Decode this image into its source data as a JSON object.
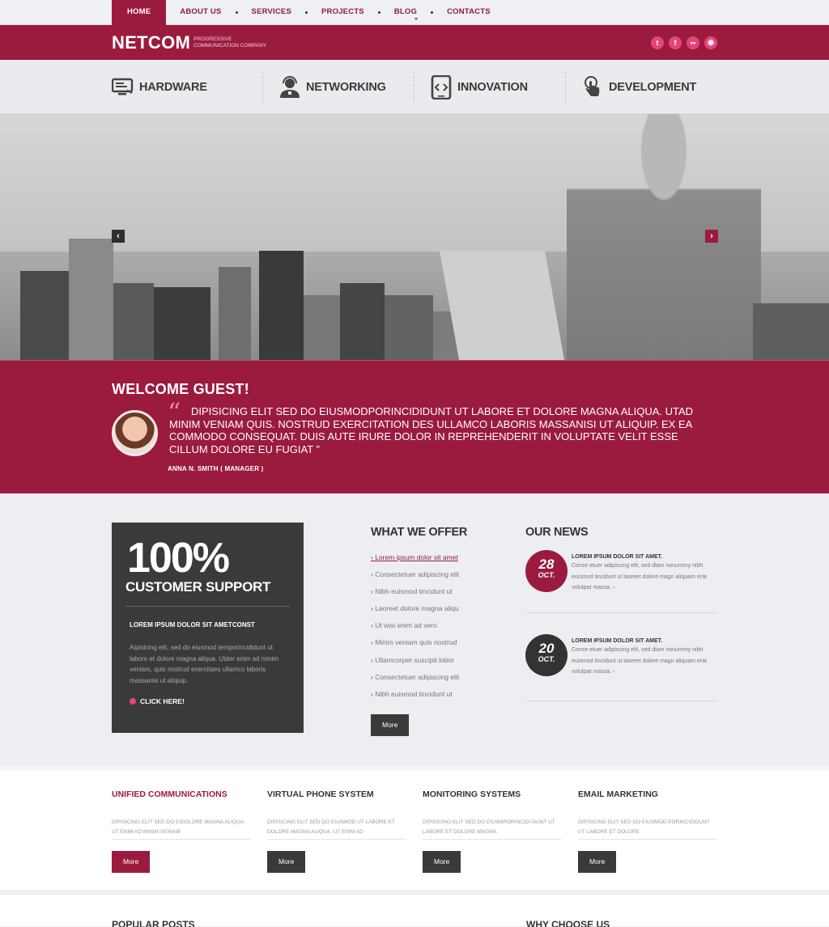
{
  "nav": {
    "items": [
      "HOME",
      "ABOUT US",
      "SERVICES",
      "PROJECTS",
      "BLOG",
      "CONTACTS"
    ]
  },
  "brand": {
    "logo": "NETCOM",
    "tagline_line1": "PROGRESSIVE",
    "tagline_line2": "COMMUNICATION COMPANY",
    "social": [
      "twitter-icon",
      "facebook-icon",
      "flickr-icon",
      "rss-icon"
    ],
    "accent_color": "#9b1b3f"
  },
  "services": [
    {
      "label": "HARDWARE",
      "icon": "monitor-icon"
    },
    {
      "label": "NETWORKING",
      "icon": "headset-user-icon"
    },
    {
      "label": "INNOVATION",
      "icon": "code-device-icon"
    },
    {
      "label": "DEVELOPMENT",
      "icon": "touch-icon"
    }
  ],
  "welcome": {
    "title": "WELCOME GUEST!",
    "quote": "DIPISICING ELIT SED DO EIUSMODPORINCIDIDUNT UT LABORE ET DOLORE MAGNA ALIQUA. UTAD MINIM VENIAM QUIS. NOSTRUD EXERCITATION DES ULLAMCO LABORIS MASSANISI UT ALIQUIP. EX EA COMMODO CONSEQUAT. DUIS AUTE IRURE DOLOR IN REPREHENDERIT IN VOLUPTATE VELIT ESSE CILLUM DOLORE EU FUGIAT ”",
    "author": "ANNA N. SMITH   ( MANAGER )"
  },
  "support": {
    "big": "100%",
    "sub": "CUSTOMER SUPPORT",
    "heading": "LOREM IPSUM DOLOR SIT AMETCONST",
    "text": "Aipisicing elit, sed do eiusmod temporincididunt ut labore et dolore magna aliqua. Utder enim ad minim veniam, quis nostrud exercitaes ullamco laboris massanisi ut aliquip.",
    "cta": "CLICK HERE!"
  },
  "offer": {
    "title": "WHAT WE OFFER",
    "items": [
      "Lorem ipsum dolor sit amet",
      "Consectetuer adipiscing elit",
      "Nibh euismod tincidunt ut",
      "Laoreet dolore magna aliqu",
      "Ut wisi enim ad vero",
      "Minim veniam quis nostrud",
      "Ullamcorper suscipit lobor",
      "Consectetuer adipiscing elit",
      "Nibh euismod tincidunt ut"
    ],
    "button": "More"
  },
  "news": {
    "title": "OUR NEWS",
    "items": [
      {
        "day": "28",
        "month": "OCT.",
        "title": "LOREM IPSUM DOLOR SIT AMET.",
        "body": "Conse etuer adipiscing elit, sed diam nonummy nibh euismod tincidunt ut laoreet dolore magn aliquam erat volutpat massa.  ›"
      },
      {
        "day": "20",
        "month": "OCT.",
        "title": "LOREM IPSUM DOLOR SIT AMET.",
        "body": "Conse etuer adipiscing elit, sed diam nonummy nibh euismod tincidunt ut laoreet dolore magn aliquam erat volutpat massa.   ›"
      }
    ]
  },
  "features": [
    {
      "title": "UNIFIED COMMUNICATIONS",
      "text": "DIPISICING ELIT SED DO EIDOLORE MAGNA ALIQUA. UT ENIM AD MINIM VENIAM",
      "button": "More"
    },
    {
      "title": "VIRTUAL PHONE SYSTEM",
      "text": "DIPISICING ELIT SED DO EIUSMOD UT LABORE ET DOLORE MAGNA ALIQUA. UT ENIM AD",
      "button": "More"
    },
    {
      "title": "MONITORING SYSTEMS",
      "text": "DIPISICING ELIT SED DO EIUSMPORINCIDI-DUNT UT LABORE ET DOLORE MAGNA.",
      "button": "More"
    },
    {
      "title": "EMAIL MARKETING",
      "text": "DIPISICING ELIT SED DO EIUSMOD PORINCIDIDUNT UT LABORE ET DOLORE",
      "button": "More"
    }
  ],
  "bottom": {
    "popular": "POPULAR POSTS",
    "why": "WHY CHOOSE US"
  }
}
